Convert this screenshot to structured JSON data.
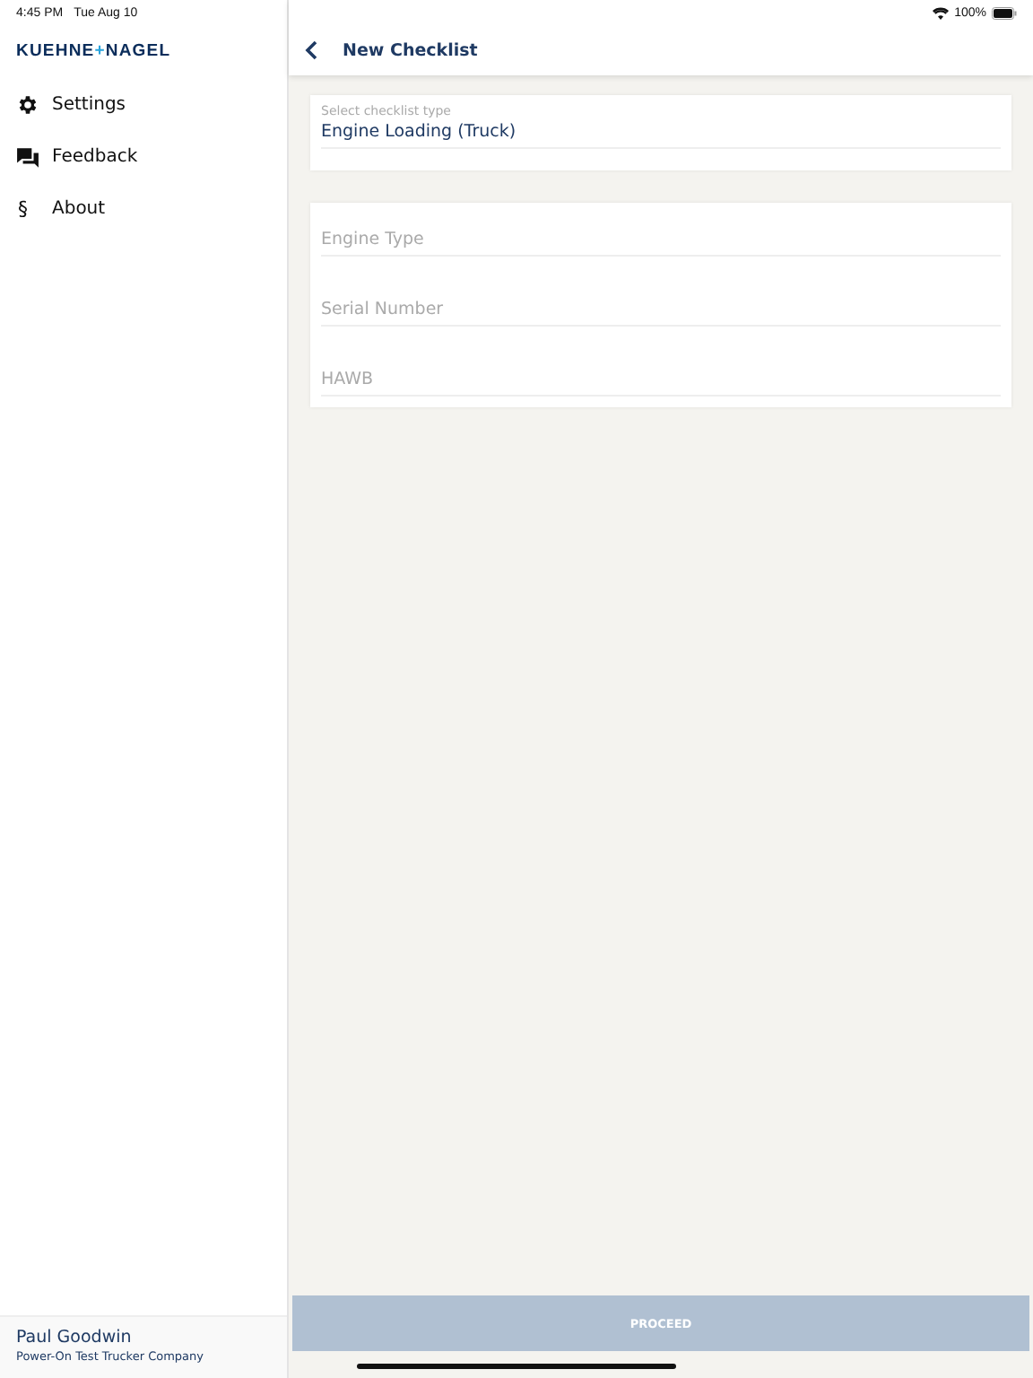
{
  "status_bar": {
    "time": "4:45 PM",
    "date": "Tue Aug 10",
    "battery": "100%"
  },
  "sidebar": {
    "logo": [
      {
        "text": "KUEHNE",
        "kind": "word"
      },
      {
        "text": "+",
        "kind": "plus"
      },
      {
        "text": "NAGEL",
        "kind": "word"
      }
    ],
    "items": [
      {
        "label": "Settings",
        "kind": "gear"
      },
      {
        "label": "Feedback",
        "kind": "chat"
      },
      {
        "label": "About",
        "kind": "glyph",
        "glyph": "§"
      }
    ],
    "user": {
      "name": "Paul Goodwin",
      "company": "Power-On Test Trucker Company"
    }
  },
  "header": {
    "title": "New Checklist"
  },
  "checklist_type": {
    "label": "Select checklist type",
    "value": "Engine Loading (Truck)"
  },
  "fields": [
    {
      "placeholder": "Engine Type"
    },
    {
      "placeholder": "Serial Number"
    },
    {
      "placeholder": "HAWB"
    }
  ],
  "proceed_button": {
    "label": "PROCEED",
    "disabled": true
  }
}
